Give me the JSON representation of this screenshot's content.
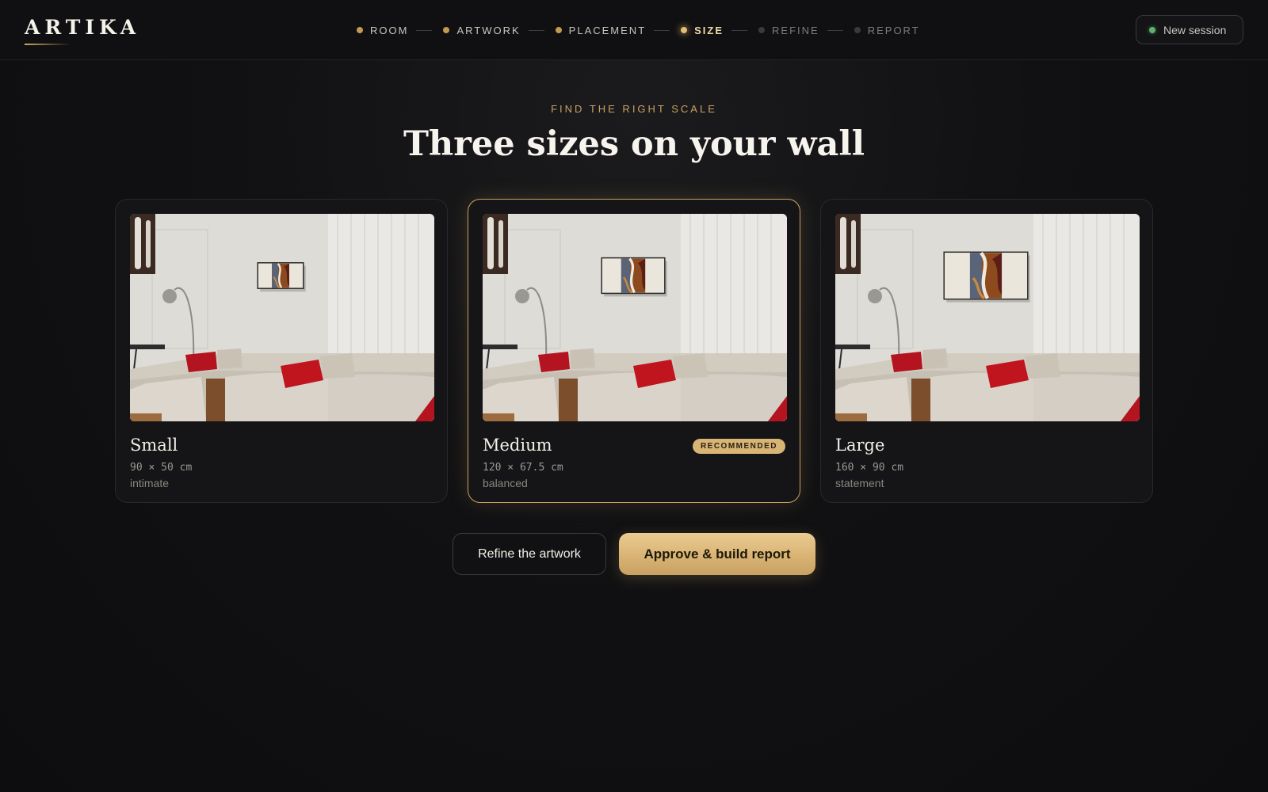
{
  "app": {
    "logo": "ARTIKA"
  },
  "steps": [
    {
      "label": "ROOM",
      "state": "done"
    },
    {
      "label": "ARTWORK",
      "state": "done"
    },
    {
      "label": "PLACEMENT",
      "state": "done"
    },
    {
      "label": "SIZE",
      "state": "active"
    },
    {
      "label": "REFINE",
      "state": "todo"
    },
    {
      "label": "REPORT",
      "state": "todo"
    }
  ],
  "header": {
    "session_label": "New session",
    "session_icon": "status-dot-icon"
  },
  "hero": {
    "eyebrow": "FIND THE RIGHT SCALE",
    "title": "Three sizes on your wall"
  },
  "sizes": [
    {
      "name": "Small",
      "dims": "90 × 50 cm",
      "mood": "intimate",
      "badge": "",
      "art_scale": 0.6
    },
    {
      "name": "Medium",
      "dims": "120 × 67.5 cm",
      "mood": "balanced",
      "badge": "RECOMMENDED",
      "art_scale": 0.83
    },
    {
      "name": "Large",
      "dims": "160 × 90 cm",
      "mood": "statement",
      "badge": "",
      "art_scale": 1.1
    }
  ],
  "actions": {
    "refine_label": "Refine the artwork",
    "approve_label": "Approve & build report"
  },
  "colors": {
    "accent": "#d8b475",
    "background": "#0f0f11",
    "card": "#151517",
    "session_status": "#5fb06c"
  }
}
